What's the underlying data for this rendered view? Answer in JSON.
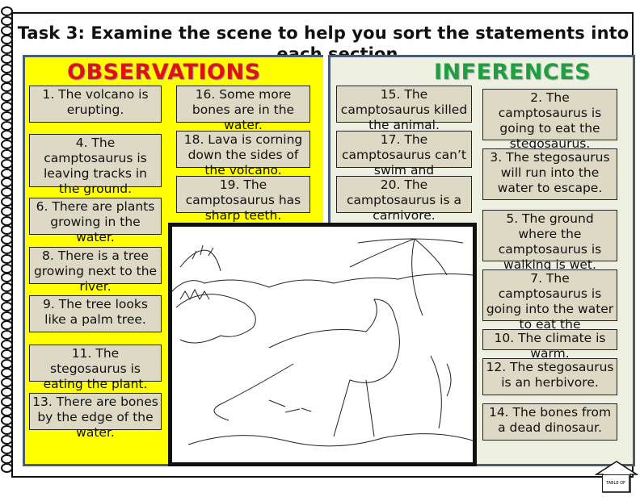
{
  "title": {
    "line1": "Task 3: Examine the scene to help you sort the statements into",
    "line2": "each section"
  },
  "observations": {
    "heading": "OBSERVATIONS",
    "color": "#e01010",
    "panel_color": "#ffff00",
    "cards": [
      {
        "id": 1,
        "text": "1. The volcano is erupting."
      },
      {
        "id": 4,
        "text": "4. The camptosaurus is leaving tracks in the ground."
      },
      {
        "id": 6,
        "text": "6. There are plants growing in the water."
      },
      {
        "id": 8,
        "text": "8. There is a tree growing next to the river."
      },
      {
        "id": 9,
        "text": "9. The tree looks like a palm tree."
      },
      {
        "id": 11,
        "text": "11. The stegosaurus is eating the plant."
      },
      {
        "id": 13,
        "text": "13. There are bones by the edge of the water."
      },
      {
        "id": 16,
        "text": "16. Some more bones are in the water."
      },
      {
        "id": 18,
        "text": "18. Lava is corning down the sides of the volcano."
      },
      {
        "id": 19,
        "text": "19. The camptosaurus has sharp teeth."
      }
    ]
  },
  "inferences": {
    "heading": "INFERENCES",
    "color": "#1fa040",
    "panel_color": "#eef0e2",
    "cards": [
      {
        "id": 15,
        "text": "15. The camptosaurus killed the animal."
      },
      {
        "id": 17,
        "text": "17. The camptosaurus can’t swim and"
      },
      {
        "id": 20,
        "text": "20. The camptosaurus is a carnivore."
      },
      {
        "id": 2,
        "text": "2. The camptosaurus is going to eat the stegosaurus."
      },
      {
        "id": 3,
        "text": "3. The stegosaurus will run into the water to escape."
      },
      {
        "id": 5,
        "text": "5. The ground where the camptosaurus is walking is wet."
      },
      {
        "id": 7,
        "text": "7. The camptosaurus is going into the water to eat the"
      },
      {
        "id": 10,
        "text": "10. The climate is warm."
      },
      {
        "id": 12,
        "text": "12. The stegosaurus is an herbivore."
      },
      {
        "id": 14,
        "text": "14. The bones from a dead dinosaur."
      }
    ]
  },
  "scene": {
    "alt": "Line drawing of a camptosaurus, a stegosaurus, a volcano, palm tree, water and bones"
  },
  "home_button": {
    "label": "TABLE OF CONTENTS",
    "icon": "house-arrow-icon"
  }
}
